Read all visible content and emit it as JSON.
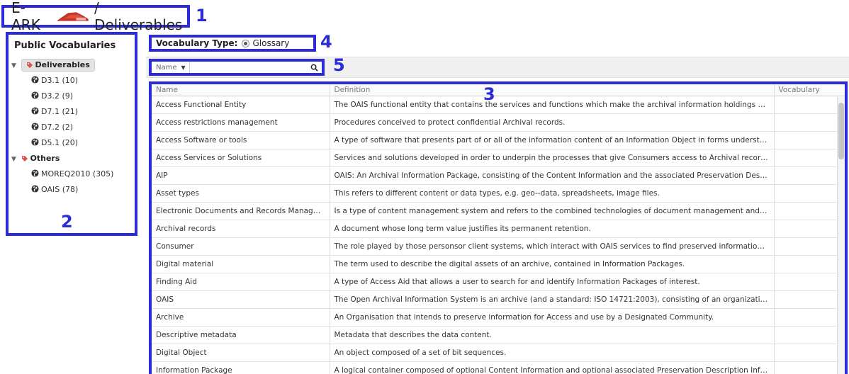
{
  "header": {
    "brand": "E-ARK",
    "breadcrumb": "/ Deliverables",
    "annotation": "1"
  },
  "sidebar": {
    "title": "Public Vocabularies",
    "annotation": "2",
    "groups": [
      {
        "label": "Deliverables",
        "selected": true,
        "items": [
          "D3.1 (10)",
          "D3.2 (9)",
          "D7.1 (21)",
          "D7.2 (2)",
          "D5.1 (20)"
        ]
      },
      {
        "label": "Others",
        "selected": false,
        "items": [
          "MOREQ2010 (305)",
          "OAIS (78)"
        ]
      }
    ]
  },
  "vocab_type": {
    "label": "Vocabulary Type:",
    "option": "Glossary",
    "annotation": "4"
  },
  "search": {
    "field_select": "Name",
    "value": "",
    "annotation": "5"
  },
  "table": {
    "annotation": "3",
    "columns": [
      "Name",
      "Definition",
      "Vocabulary"
    ],
    "rows": [
      [
        "Access Functional Entity",
        "The OAIS functional entity that contains the services and functions which make the archival information holdings and relate...",
        ""
      ],
      [
        "Access restrictions management",
        "Procedures conceived to protect confidential Archival records.",
        ""
      ],
      [
        "Access Software or tools",
        "A type of software that presents part of or all of the information content of an Information Object in forms understandable t...",
        ""
      ],
      [
        "Access Services or Solutions",
        "Services and solutions developed in order to underpin the processes that give Consumers access to Archival records.",
        ""
      ],
      [
        "AIP",
        "OAIS: An Archival Information Package, consisting of the Content Information and the associated Preservation Description I...",
        ""
      ],
      [
        "Asset types",
        "This refers to different content or data types, e.g. geo--data, spreadsheets, image files.",
        ""
      ],
      [
        "Electronic Documents and Records Manageme...",
        "Is a type of content management system and refers to the combined technologies of document management and records ...",
        ""
      ],
      [
        "Archival records",
        "A document whose long term value justifies its permanent retention.",
        ""
      ],
      [
        "Consumer",
        "The role played by those personsor client systems, which interact with OAIS services to find preserved information of interes...",
        ""
      ],
      [
        "Digital material",
        "The term used to describe the digital assets of an archive, contained in Information Packages.",
        ""
      ],
      [
        "Finding Aid",
        "A type of Access Aid that allows a user to search for and identify Information Packages of interest.",
        ""
      ],
      [
        "OAIS",
        "The Open Archival Information System is an archive (and a standard: ISO 14721:2003), consisting of an organization of peop...",
        ""
      ],
      [
        "Archive",
        "An Organisation that intends to preserve information for Access and use by a Designated Community.",
        ""
      ],
      [
        "Descriptive metadata",
        "Metadata that describes the data content.",
        ""
      ],
      [
        "Digital Object",
        "An object composed of a set of bit sequences.",
        ""
      ],
      [
        "Information Package",
        "A logical container composed of optional Content Information and optional associated Preservation Description Informatio...",
        ""
      ]
    ]
  },
  "colors": {
    "annotation_blue": "#2b2bd9",
    "tag_red": "#d9534f",
    "logo_red": "#c0392b"
  }
}
